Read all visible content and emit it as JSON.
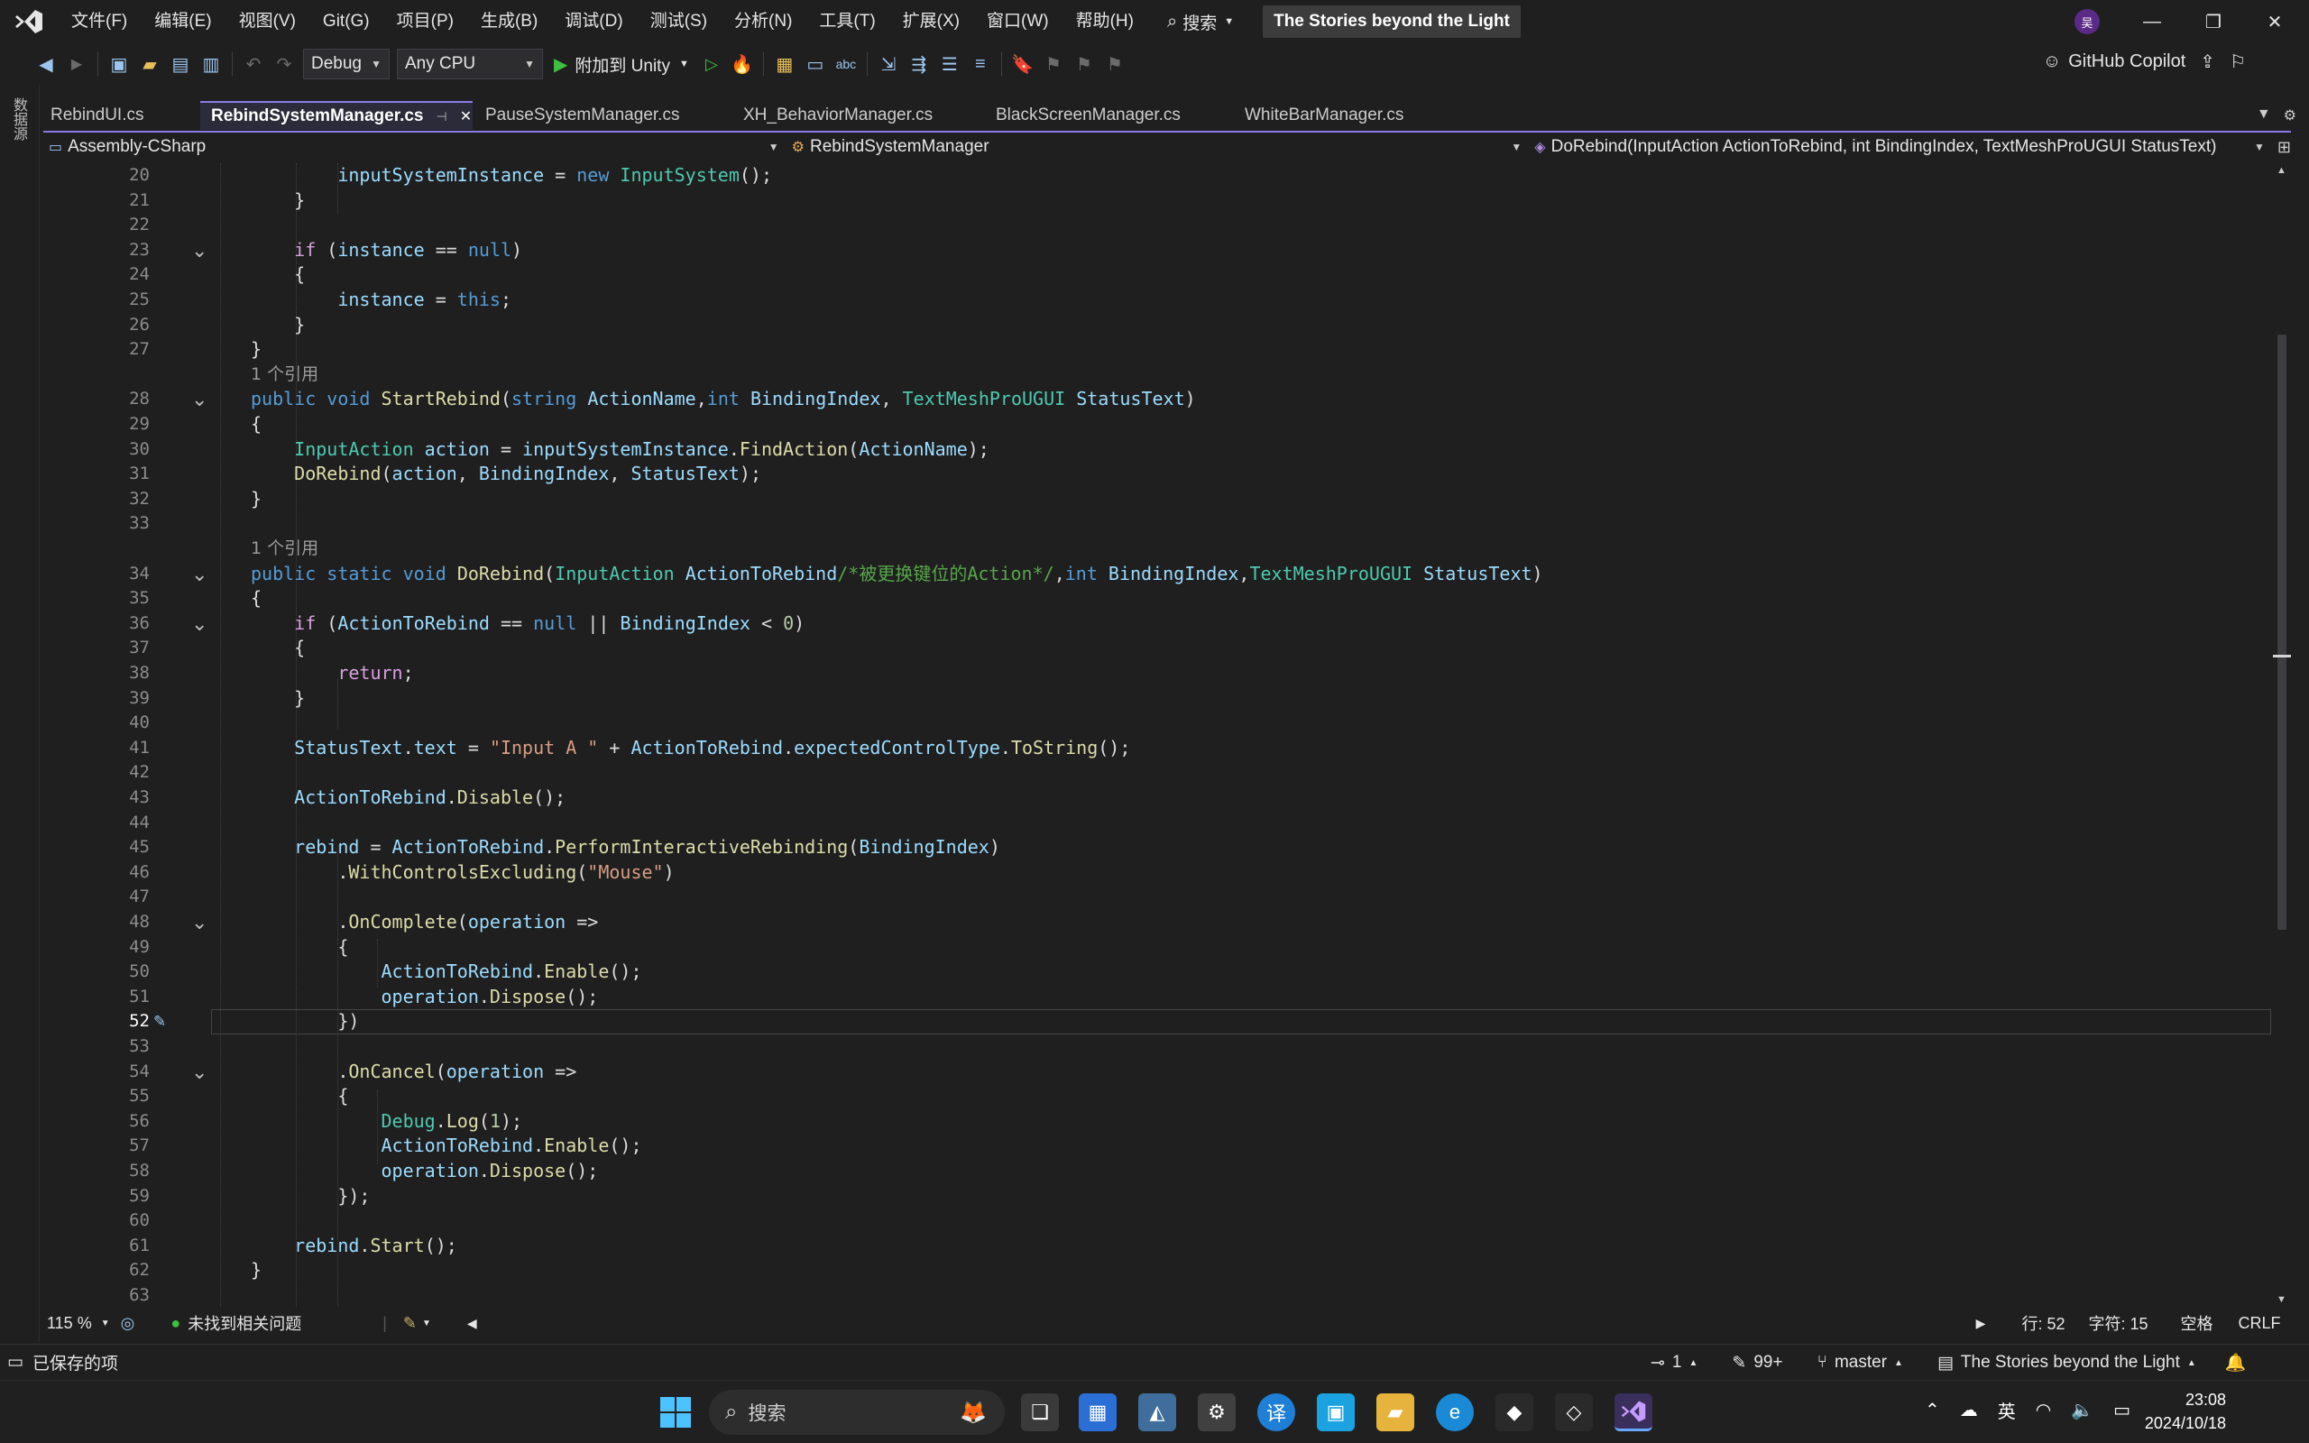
{
  "menu": [
    "文件(F)",
    "编辑(E)",
    "视图(V)",
    "Git(G)",
    "项目(P)",
    "生成(B)",
    "调试(D)",
    "测试(S)",
    "分析(N)",
    "工具(T)",
    "扩展(X)",
    "窗口(W)",
    "帮助(H)"
  ],
  "search_label": "搜索",
  "solution_name": "The Stories beyond the Light",
  "user_initial": "吴",
  "toolbar": {
    "config": "Debug",
    "platform": "Any CPU",
    "attach_label": "附加到 Unity",
    "copilot_label": "GitHub Copilot"
  },
  "side_label": "数据源",
  "tabs": [
    {
      "label": "RebindUI.cs",
      "active": false
    },
    {
      "label": "RebindSystemManager.cs",
      "active": true
    },
    {
      "label": "PauseSystemManager.cs",
      "active": false
    },
    {
      "label": "XH_BehaviorManager.cs",
      "active": false
    },
    {
      "label": "BlackScreenManager.cs",
      "active": false
    },
    {
      "label": "WhiteBarManager.cs",
      "active": false
    }
  ],
  "nav": {
    "project": "Assembly-CSharp",
    "class": "RebindSystemManager",
    "member": "DoRebind(InputAction ActionToRebind, int BindingIndex, TextMeshProUGUI StatusText)"
  },
  "code_lines": [
    {
      "n": "20",
      "html": "        <span class=\"vr\">inputSystemInstance</span> = <span class=\"kw\">new</span> <span class=\"ty\">InputSystem</span>();"
    },
    {
      "n": "21",
      "html": "    }"
    },
    {
      "n": "22",
      "html": ""
    },
    {
      "n": "23",
      "fold": true,
      "html": "    <span class=\"ctl\">if</span> (<span class=\"vr\">instance</span> == <span class=\"kw\">null</span>)"
    },
    {
      "n": "24",
      "html": "    {"
    },
    {
      "n": "25",
      "html": "        <span class=\"vr\">instance</span> = <span class=\"kw\">this</span>;"
    },
    {
      "n": "26",
      "html": "    }"
    },
    {
      "n": "27",
      "html": "}"
    },
    {
      "n": "",
      "ref": "1 个引用"
    },
    {
      "n": "28",
      "fold": true,
      "html": "<span class=\"kw\">public</span> <span class=\"kw\">void</span> <span class=\"fn\">StartRebind</span>(<span class=\"kw\">string</span> <span class=\"vr\">ActionName</span>,<span class=\"kw\">int</span> <span class=\"vr\">BindingIndex</span>, <span class=\"ty\">TextMeshProUGUI</span> <span class=\"vr\">StatusText</span>)"
    },
    {
      "n": "29",
      "html": "{"
    },
    {
      "n": "30",
      "html": "    <span class=\"ty\">InputAction</span> <span class=\"vr\">action</span> = <span class=\"vr\">inputSystemInstance</span>.<span class=\"fn\">FindAction</span>(<span class=\"vr\">ActionName</span>);"
    },
    {
      "n": "31",
      "html": "    <span class=\"fn\">DoRebind</span>(<span class=\"vr\">action</span>, <span class=\"vr\">BindingIndex</span>, <span class=\"vr\">StatusText</span>);"
    },
    {
      "n": "32",
      "html": "}"
    },
    {
      "n": "33",
      "html": ""
    },
    {
      "n": "",
      "ref": "1 个引用"
    },
    {
      "n": "34",
      "fold": true,
      "html": "<span class=\"kw\">public</span> <span class=\"kw\">static</span> <span class=\"kw\">void</span> <span class=\"fn\">DoRebind</span>(<span class=\"ty\">InputAction</span> <span class=\"vr\">ActionToRebind</span><span class=\"cm\">/*被更换键位的Action*/</span>,<span class=\"kw\">int</span> <span class=\"vr\">BindingIndex</span>,<span class=\"ty\">TextMeshProUGUI</span> <span class=\"vr\">StatusText</span>)"
    },
    {
      "n": "35",
      "html": "{"
    },
    {
      "n": "36",
      "fold": true,
      "html": "    <span class=\"ctl\">if</span> (<span class=\"vr\">ActionToRebind</span> == <span class=\"kw\">null</span> || <span class=\"vr\">BindingIndex</span> &lt; <span class=\"nm\">0</span>)"
    },
    {
      "n": "37",
      "html": "    {"
    },
    {
      "n": "38",
      "html": "        <span class=\"ctl\">return</span>;"
    },
    {
      "n": "39",
      "html": "    }"
    },
    {
      "n": "40",
      "html": ""
    },
    {
      "n": "41",
      "html": "    <span class=\"vr\">StatusText</span>.<span class=\"vr\">text</span> = <span class=\"st\">\"Input A \"</span> + <span class=\"vr\">ActionToRebind</span>.<span class=\"vr\">expectedControlType</span>.<span class=\"fn\">ToString</span>();"
    },
    {
      "n": "42",
      "html": ""
    },
    {
      "n": "43",
      "html": "    <span class=\"vr\">ActionToRebind</span>.<span class=\"fn\">Disable</span>();"
    },
    {
      "n": "44",
      "html": ""
    },
    {
      "n": "45",
      "html": "    <span class=\"vr\">rebind</span> = <span class=\"vr\">ActionToRebind</span>.<span class=\"fn\">PerformInteractiveRebinding</span>(<span class=\"vr\">BindingIndex</span>)"
    },
    {
      "n": "46",
      "html": "        .<span class=\"fn\">WithControlsExcluding</span>(<span class=\"st\">\"Mouse\"</span>)"
    },
    {
      "n": "47",
      "html": ""
    },
    {
      "n": "48",
      "fold": true,
      "html": "        .<span class=\"fn\">OnComplete</span>(<span class=\"vr\">operation</span> =&gt;"
    },
    {
      "n": "49",
      "html": "        {"
    },
    {
      "n": "50",
      "html": "            <span class=\"vr\">ActionToRebind</span>.<span class=\"fn\">Enable</span>();"
    },
    {
      "n": "51",
      "html": "            <span class=\"vr\">operation</span>.<span class=\"fn\">Dispose</span>();"
    },
    {
      "n": "52",
      "current": true,
      "html": "        })"
    },
    {
      "n": "53",
      "html": ""
    },
    {
      "n": "54",
      "fold": true,
      "html": "        .<span class=\"fn\">OnCancel</span>(<span class=\"vr\">operation</span> =&gt;"
    },
    {
      "n": "55",
      "html": "        {"
    },
    {
      "n": "56",
      "html": "            <span class=\"ty\">Debug</span>.<span class=\"fn\">Log</span>(<span class=\"nm\">1</span>);"
    },
    {
      "n": "57",
      "html": "            <span class=\"vr\">ActionToRebind</span>.<span class=\"fn\">Enable</span>();"
    },
    {
      "n": "58",
      "html": "            <span class=\"vr\">operation</span>.<span class=\"fn\">Dispose</span>();"
    },
    {
      "n": "59",
      "html": "        });"
    },
    {
      "n": "60",
      "html": ""
    },
    {
      "n": "61",
      "html": "    <span class=\"vr\">rebind</span>.<span class=\"fn\">Start</span>();"
    },
    {
      "n": "62",
      "html": "}"
    },
    {
      "n": "63",
      "html": ""
    }
  ],
  "editor_status": {
    "zoom": "115 %",
    "issues": "未找到相关问题",
    "line": "行: 52",
    "char": "字符: 15",
    "spacing": "空格",
    "eol": "CRLF"
  },
  "statusbar": {
    "saved": "已保存的项",
    "commits": "1",
    "changes": "99+",
    "branch": "master",
    "repo": "The Stories beyond the Light"
  },
  "taskbar": {
    "search": "搜索",
    "ime": "英",
    "time": "23:08",
    "date": "2024/10/18"
  }
}
